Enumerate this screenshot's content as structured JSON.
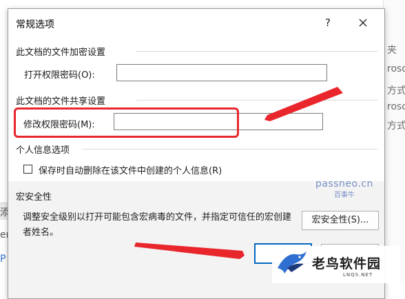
{
  "background": {
    "right_fragments": [
      "夹",
      "roso",
      "方式",
      "roso",
      "方式"
    ],
    "left_fragments": [
      "添",
      "er",
      "P"
    ]
  },
  "dialog": {
    "title": "常规选项",
    "help_label": "?",
    "encryption": {
      "header": "此文档的文件加密设置",
      "open_password_label": "打开权限密码(O):",
      "open_password_value": ""
    },
    "sharing": {
      "header": "此文档的文件共享设置",
      "modify_password_label": "修改权限密码(M):",
      "modify_password_value": ""
    },
    "privacy": {
      "header": "个人信息选项",
      "remove_info_label": "保存时自动删除在该文件中创建的个人信息(R)",
      "remove_info_checked": false
    },
    "macro": {
      "header": "宏安全性",
      "description": "调整安全级别以打开可能包含宏病毒的文件，并指定可信任的宏创建者姓名。",
      "button_label": "宏安全性(S)..."
    }
  },
  "watermark": {
    "main": "passneo.cn",
    "sub": "百事牛"
  },
  "logo": {
    "name": "老鸟软件园",
    "url": "LNQS.NET"
  },
  "colors": {
    "annotation_red": "#e8262c",
    "accent_blue": "#0067c0"
  }
}
